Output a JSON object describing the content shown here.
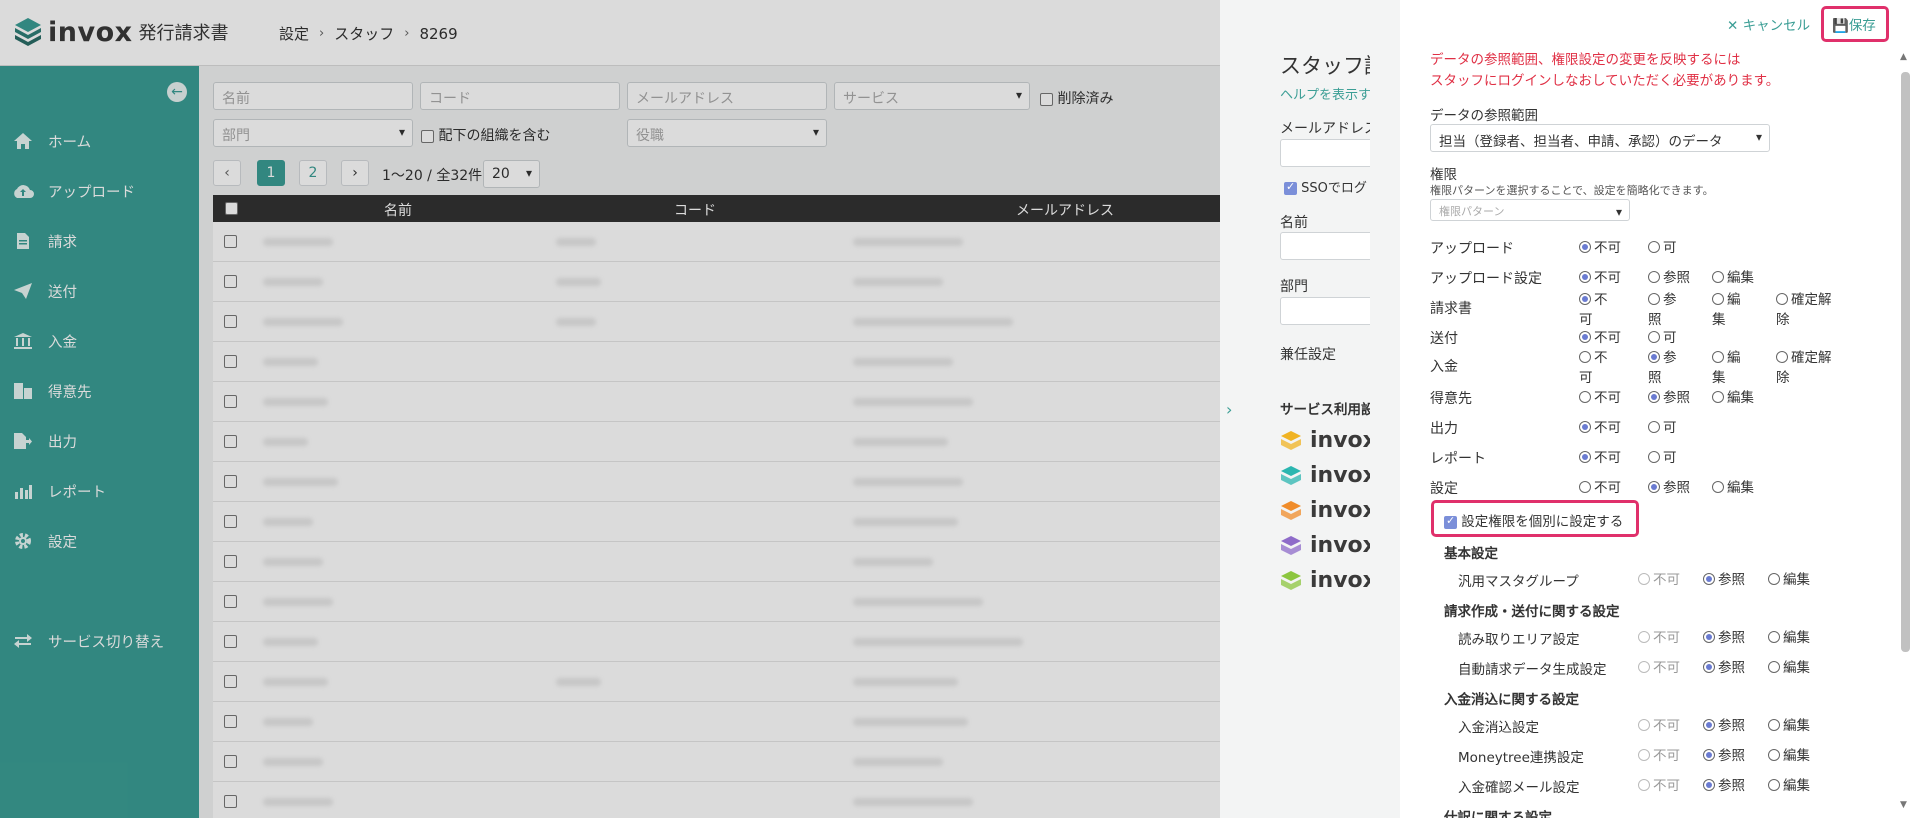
{
  "header": {
    "brand": "invox",
    "product": "発行請求書",
    "breadcrumb": [
      "設定",
      "スタッフ",
      "8269"
    ]
  },
  "sidebar": {
    "items": [
      {
        "label": "ホーム",
        "icon": "home-icon"
      },
      {
        "label": "アップロード",
        "icon": "cloud-upload-icon"
      },
      {
        "label": "請求",
        "icon": "document-icon"
      },
      {
        "label": "送付",
        "icon": "send-icon"
      },
      {
        "label": "入金",
        "icon": "bank-icon"
      },
      {
        "label": "得意先",
        "icon": "building-icon"
      },
      {
        "label": "出力",
        "icon": "export-icon"
      },
      {
        "label": "レポート",
        "icon": "chart-icon"
      },
      {
        "label": "設定",
        "icon": "gear-icon"
      },
      {
        "label": "サービス切り替え",
        "icon": "switch-icon"
      }
    ]
  },
  "filters": {
    "name_ph": "名前",
    "code_ph": "コード",
    "email_ph": "メールアドレス",
    "service_ph": "サービス",
    "deleted_label": "削除済み",
    "dept_ph": "部門",
    "include_sub_label": "配下の組織を含む",
    "role_ph": "役職"
  },
  "pagination": {
    "pages": [
      "1",
      "2"
    ],
    "summary": "1〜20 / 全32件",
    "per_page": "20"
  },
  "table": {
    "columns": [
      "名前",
      "コード",
      "メールアドレス"
    ]
  },
  "staff_panel": {
    "title": "スタッフ詳",
    "help": "ヘルプを表示す",
    "email_label": "メールアドレス",
    "sso_label": "SSOでログ",
    "name_label": "名前",
    "dept_label": "部門",
    "concurrent_label": "兼任設定",
    "service_label": "サービス利用設",
    "services": [
      "invox",
      "invox",
      "invox",
      "invox",
      "invox"
    ],
    "service_colors": [
      "#f0b323",
      "#2bb6b0",
      "#f08c2a",
      "#8e6bc9",
      "#8cc63f"
    ]
  },
  "permission_panel": {
    "cancel_label": "キャンセル",
    "save_label": "保存",
    "warning_line1": "データの参照範囲、権限設定の変更を反映するには",
    "warning_line2": "スタッフにログインしなおしていただく必要があります。",
    "scope_label": "データの参照範囲",
    "scope_value": "担当（登録者、担当者、申請、承認）のデータ",
    "perm_label": "権限",
    "perm_help": "権限パターンを選択することで、設定を簡略化できます。",
    "perm_pattern_ph": "権限パターン",
    "rows": [
      {
        "label": "アップロード",
        "opts": [
          "不可",
          "可"
        ],
        "sel": 0
      },
      {
        "label": "アップロード設定",
        "opts": [
          "不可",
          "参照",
          "編集"
        ],
        "sel": 0
      },
      {
        "label": "請求書",
        "opts": [
          "不可",
          "参照",
          "編集",
          "確定解除"
        ],
        "sel": 0
      },
      {
        "label": "送付",
        "opts": [
          "不可",
          "可"
        ],
        "sel": 0
      },
      {
        "label": "入金",
        "opts": [
          "不可",
          "参照",
          "編集",
          "確定解除"
        ],
        "sel": 1
      },
      {
        "label": "得意先",
        "opts": [
          "不可",
          "参照",
          "編集"
        ],
        "sel": 1
      },
      {
        "label": "出力",
        "opts": [
          "不可",
          "可"
        ],
        "sel": 0
      },
      {
        "label": "レポート",
        "opts": [
          "不可",
          "可"
        ],
        "sel": 0
      },
      {
        "label": "設定",
        "opts": [
          "不可",
          "参照",
          "編集"
        ],
        "sel": 1
      }
    ],
    "individual_label": "設定権限を個別に設定する",
    "sections": [
      {
        "title": "基本設定",
        "items": [
          "汎用マスタグループ"
        ]
      },
      {
        "title": "請求作成・送付に関する設定",
        "items": [
          "読み取りエリア設定",
          "自動請求データ生成設定"
        ]
      },
      {
        "title": "入金消込に関する設定",
        "items": [
          "入金消込設定",
          "Moneytree連携設定",
          "入金確認メール設定"
        ]
      },
      {
        "title": "仕訳に関する設定",
        "items": []
      }
    ],
    "sub_opts": [
      "不可",
      "参照",
      "編集"
    ]
  },
  "colors": {
    "sidebar": "#3b9e95",
    "accent": "#3b9e95",
    "highlight": "#e0306b",
    "warning": "#e03045",
    "radio": "#6a7bd1"
  }
}
